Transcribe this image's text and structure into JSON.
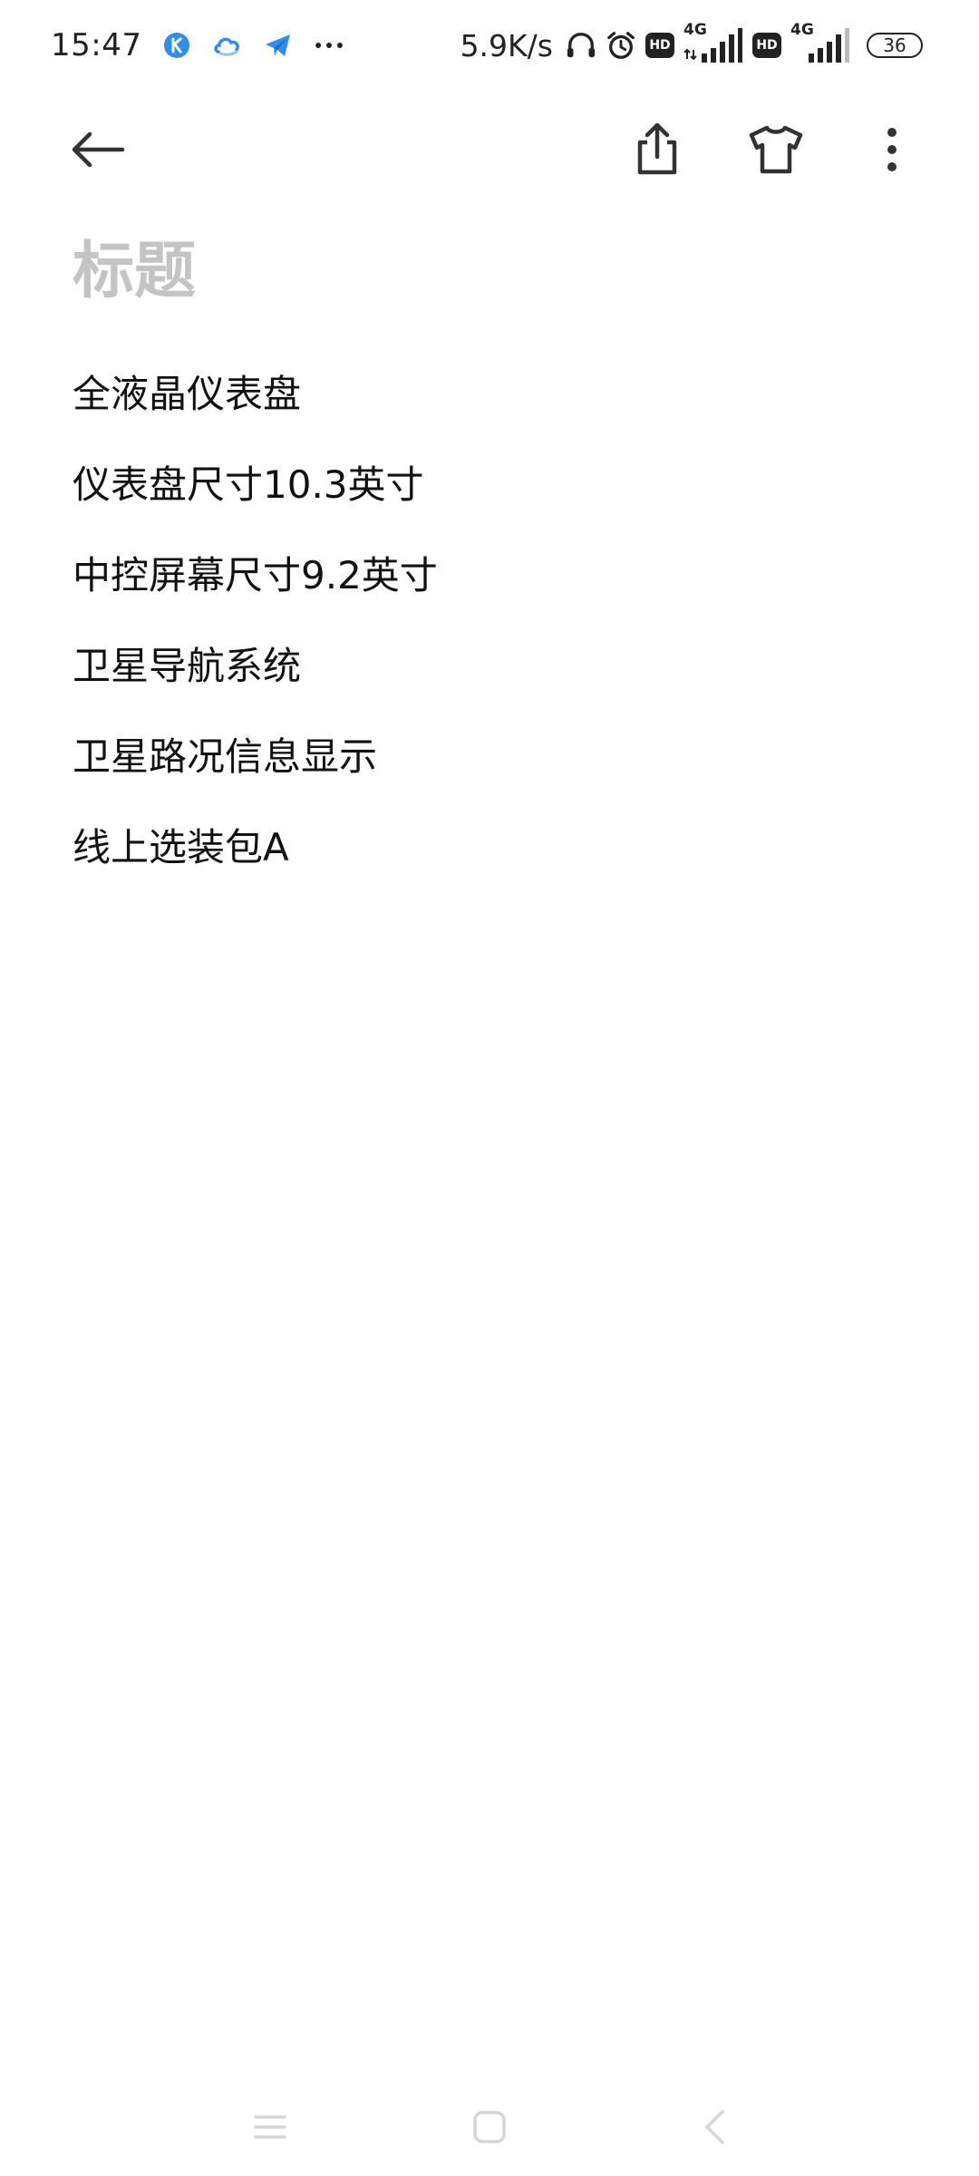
{
  "status_bar": {
    "time": "15:47",
    "network_speed": "5.9K/s",
    "sim1_label": "4G",
    "sim2_label": "4G",
    "hd_label": "HD",
    "battery_level": "36",
    "notification_icons": [
      "k-app-icon",
      "cloud-app-icon",
      "telegram-icon",
      "more-notifications-icon"
    ]
  },
  "toolbar": {
    "back_icon": "arrow-left-icon",
    "share_icon": "share-icon",
    "theme_icon": "tshirt-icon",
    "more_icon": "more-vertical-icon"
  },
  "note": {
    "title_placeholder": "标题",
    "lines": [
      "全液晶仪表盘",
      "仪表盘尺寸10.3英寸",
      "中控屏幕尺寸9.2英寸",
      "卫星导航系统",
      "卫星路况信息显示",
      "线上选装包A"
    ]
  },
  "nav_bar": {
    "buttons": [
      "menu-icon",
      "home-icon",
      "back-icon"
    ]
  },
  "colors": {
    "text": "#111111",
    "placeholder": "#c4c4c4",
    "icon": "#333333",
    "nav": "#d6d6d6",
    "accent_blue": "#2f8cf0"
  }
}
